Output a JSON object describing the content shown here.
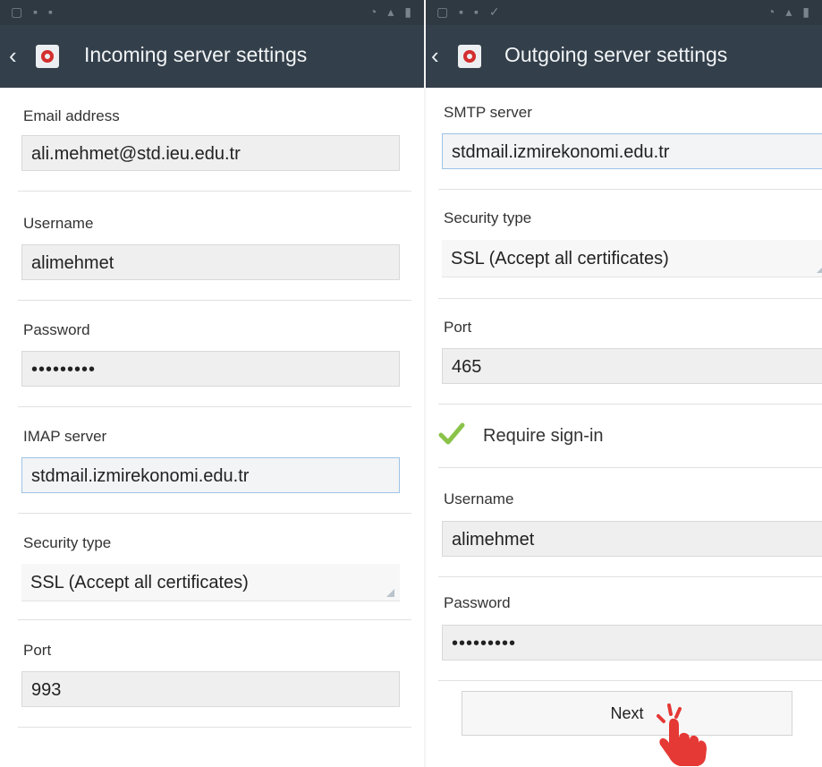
{
  "incoming": {
    "title": "Incoming server settings",
    "email": {
      "label": "Email address",
      "value": "ali.mehmet@std.ieu.edu.tr"
    },
    "username": {
      "label": "Username",
      "value": "alimehmet"
    },
    "password": {
      "label": "Password",
      "value": "•••••••••"
    },
    "imap": {
      "label": "IMAP server",
      "value": "stdmail.izmirekonomi.edu.tr"
    },
    "security": {
      "label": "Security type",
      "value": "SSL (Accept all certificates)"
    },
    "port": {
      "label": "Port",
      "value": "993"
    }
  },
  "outgoing": {
    "title": "Outgoing server settings",
    "smtp": {
      "label": "SMTP server",
      "value": "stdmail.izmirekonomi.edu.tr"
    },
    "security": {
      "label": "Security type",
      "value": "SSL (Accept all certificates)"
    },
    "port": {
      "label": "Port",
      "value": "465"
    },
    "require_signin": {
      "label": "Require sign-in",
      "checked": true
    },
    "username": {
      "label": "Username",
      "value": "alimehmet"
    },
    "password": {
      "label": "Password",
      "value": "•••••••••"
    },
    "next_label": "Next"
  },
  "colors": {
    "appbar": "#333f4a",
    "check": "#8bc34a",
    "hand": "#e53935",
    "focus_border": "#9cc3e6"
  },
  "icons": {
    "back": "chevron-left-icon",
    "app": "email-app-icon",
    "check": "checkmark-icon",
    "pointer": "pointing-hand-icon"
  }
}
